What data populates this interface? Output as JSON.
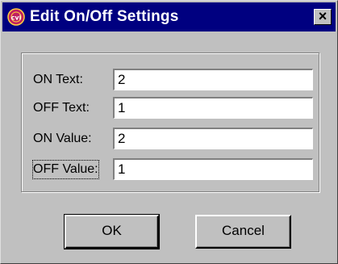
{
  "window": {
    "title": "Edit On/Off Settings",
    "close_glyph": "×",
    "icon_name": "cvi-icon"
  },
  "fields": [
    {
      "label": "ON Text:",
      "value": "2"
    },
    {
      "label": "OFF Text:",
      "value": "1"
    },
    {
      "label": "ON Value:",
      "value": "2"
    },
    {
      "label": "OFF Value:",
      "value": "1"
    }
  ],
  "buttons": {
    "ok": "OK",
    "cancel": "Cancel"
  },
  "colors": {
    "titlebar": "#000080",
    "face": "#c0c0c0"
  }
}
